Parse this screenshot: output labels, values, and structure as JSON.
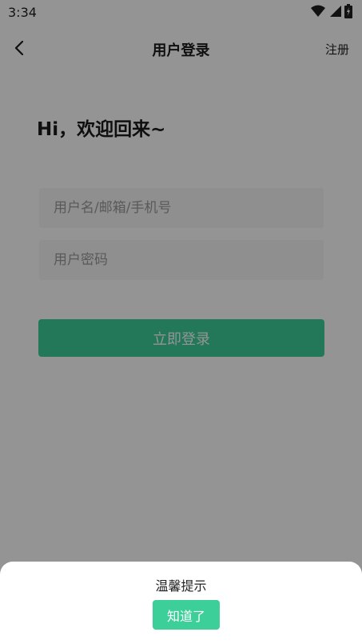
{
  "status_bar": {
    "time": "3:34",
    "icons": [
      "wifi-icon",
      "signal-icon",
      "battery-icon"
    ]
  },
  "nav": {
    "back_icon": "chevron-left-icon",
    "title": "用户登录",
    "register_label": "注册"
  },
  "login": {
    "greeting": "Hi，欢迎回来~",
    "username_placeholder": "用户名/邮箱/手机号",
    "username_value": "",
    "password_placeholder": "用户密码",
    "password_value": "",
    "submit_label": "立即登录"
  },
  "dialog": {
    "title": "温馨提示",
    "confirm_label": "知道了"
  },
  "colors": {
    "accent": "#3ccf9a",
    "overlay": "rgba(0,0,0,0.42)"
  }
}
